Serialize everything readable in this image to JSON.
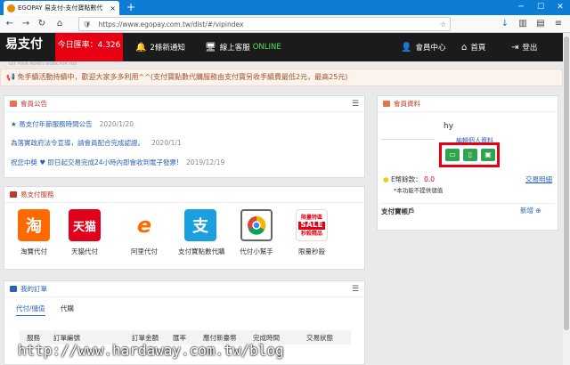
{
  "browser": {
    "tab_title": "EGOPAY 易支付-支付寶點數代",
    "url": "https://www.egopay.com.tw/dist/#/vipindex",
    "tab_close": "×",
    "new_tab": "+"
  },
  "header": {
    "logo": "易支付",
    "logo_tagline": "LET YOUR MONEY WORK FOR YOU",
    "rate_label": "今日匯率：4.326",
    "notifications": "2條新通知",
    "support": "線上客服",
    "support_status": "ONLINE",
    "member_center": "會員中心",
    "home": "首頁",
    "logout": "登出"
  },
  "notice": "免手續活動持續中，歡迎大家多多利用^^(支付寶點數代購服務由支付寶另收手續費最低2元，最高25元)",
  "announcements": {
    "title": "會員公告",
    "items": [
      {
        "text": "★ 易支付年節服務時間公告",
        "date": "2020/1/20"
      },
      {
        "text": "為落實政府法令宣導，請會員配合完成認證。",
        "date": "2020/1/1"
      },
      {
        "text": "祝您中獎 ♥ 即日起交易完成24小時內即會收到電子發票!",
        "date": "2019/12/19"
      }
    ]
  },
  "services": {
    "title": "易支付服務",
    "items": [
      {
        "label": "淘寶代付",
        "glyph": "淘"
      },
      {
        "label": "天貓代付",
        "glyph": "天猫"
      },
      {
        "label": "阿里代付",
        "glyph": "e"
      },
      {
        "label": "支付寶點數代購",
        "glyph": "支"
      },
      {
        "label": "代付小幫手",
        "glyph": ""
      },
      {
        "label": "限量秒殺",
        "glyph": "SALE"
      }
    ],
    "sale_badge": "限量特區",
    "sale_sub": "秒殺精品"
  },
  "orders": {
    "title": "我的訂單",
    "tabs": [
      "代付/儲值",
      "代購"
    ],
    "columns": [
      "服務",
      "訂單編號",
      "訂單金額",
      "匯率",
      "應付新臺幣",
      "完成時間",
      "交易狀態"
    ]
  },
  "member": {
    "title": "會員資料",
    "username": "hy",
    "edit_link": "編輯個人資料",
    "balance_label": "E幣餘款：",
    "balance_value": "0.0",
    "balance_note": "*本功能不提供儲值",
    "txn_link": "交易明細",
    "alipay_title": "支付寶帳戶",
    "add_label": "新增"
  },
  "watermark": "http://www.hardaway.com.tw/blog",
  "colors": {
    "accent_red": "#e60012",
    "browser_blue": "#0c7cd5",
    "link_blue": "#2a62b8",
    "green": "#2ea44f"
  }
}
